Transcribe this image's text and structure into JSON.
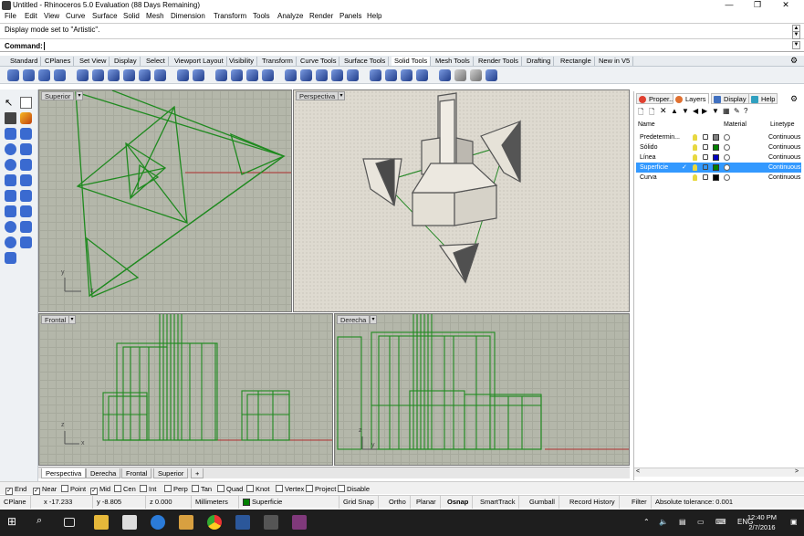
{
  "window": {
    "title": "Untitled - Rhinoceros 5.0 Evaluation (88 Days Remaining)",
    "minimize": "—",
    "restore": "❐",
    "close": "✕"
  },
  "menu": [
    "File",
    "Edit",
    "View",
    "Curve",
    "Surface",
    "Solid",
    "Mesh",
    "Dimension",
    "Transform",
    "Tools",
    "Analyze",
    "Render",
    "Panels",
    "Help"
  ],
  "command": {
    "history": "Display mode set to \"Artistic\".",
    "label": "Command:",
    "value": ""
  },
  "toolbar_tabs": [
    "Standard",
    "CPlanes",
    "Set View",
    "Display",
    "Select",
    "Viewport Layout",
    "Visibility",
    "Transform",
    "Curve Tools",
    "Surface Tools",
    "Solid Tools",
    "Mesh Tools",
    "Render Tools",
    "Drafting",
    "Rectangle",
    "New in V5"
  ],
  "active_toolbar_tab": "Solid Tools",
  "viewports": {
    "top": "Superior",
    "perspective": "Perspectiva",
    "front": "Frontal",
    "right": "Derecha"
  },
  "axis": {
    "x": "x",
    "y": "y",
    "z": "z"
  },
  "view_tabs": [
    "Perspectiva",
    "Derecha",
    "Frontal",
    "Superior"
  ],
  "add_view": "+",
  "panel": {
    "tabs": [
      "Proper...",
      "Layers",
      "Display",
      "Help"
    ],
    "columns": {
      "name": "Name",
      "material": "Material",
      "linetype": "Linetype"
    },
    "layers": [
      {
        "name": "Predetermin...",
        "color": "#808080",
        "linetype": "Continuous",
        "current": false,
        "selected": false
      },
      {
        "name": "Sólido",
        "color": "#008000",
        "linetype": "Continuous",
        "current": false,
        "selected": false
      },
      {
        "name": "Línea",
        "color": "#0000c0",
        "linetype": "Continuous",
        "current": false,
        "selected": false
      },
      {
        "name": "Superficie",
        "color": "#008000",
        "linetype": "Continuous",
        "current": true,
        "selected": true
      },
      {
        "name": "Curva",
        "color": "#000000",
        "linetype": "Continuous",
        "current": false,
        "selected": false
      }
    ],
    "check": "✓"
  },
  "osnap": [
    {
      "label": "End",
      "checked": true
    },
    {
      "label": "Near",
      "checked": true
    },
    {
      "label": "Point",
      "checked": false
    },
    {
      "label": "Mid",
      "checked": true
    },
    {
      "label": "Cen",
      "checked": false
    },
    {
      "label": "Int",
      "checked": false
    },
    {
      "label": "Perp",
      "checked": false
    },
    {
      "label": "Tan",
      "checked": false
    },
    {
      "label": "Quad",
      "checked": false
    },
    {
      "label": "Knot",
      "checked": false
    },
    {
      "label": "Vertex",
      "checked": false
    },
    {
      "label": "Project",
      "checked": false
    },
    {
      "label": "Disable",
      "checked": false
    }
  ],
  "status": {
    "cplane": "CPlane",
    "x": "x -17.233",
    "y": "y -8.805",
    "z": "z 0.000",
    "units": "Millimeters",
    "layer": "Superficie",
    "layer_color": "#008000",
    "toggles": [
      "Grid Snap",
      "Ortho",
      "Planar",
      "Osnap",
      "SmartTrack",
      "Gumball",
      "Record History",
      "Filter"
    ],
    "active_toggle": "Osnap",
    "tolerance": "Absolute tolerance: 0.001"
  },
  "taskbar": {
    "time": "12:40 PM",
    "date": "2/7/2016",
    "lang": "ENG"
  }
}
